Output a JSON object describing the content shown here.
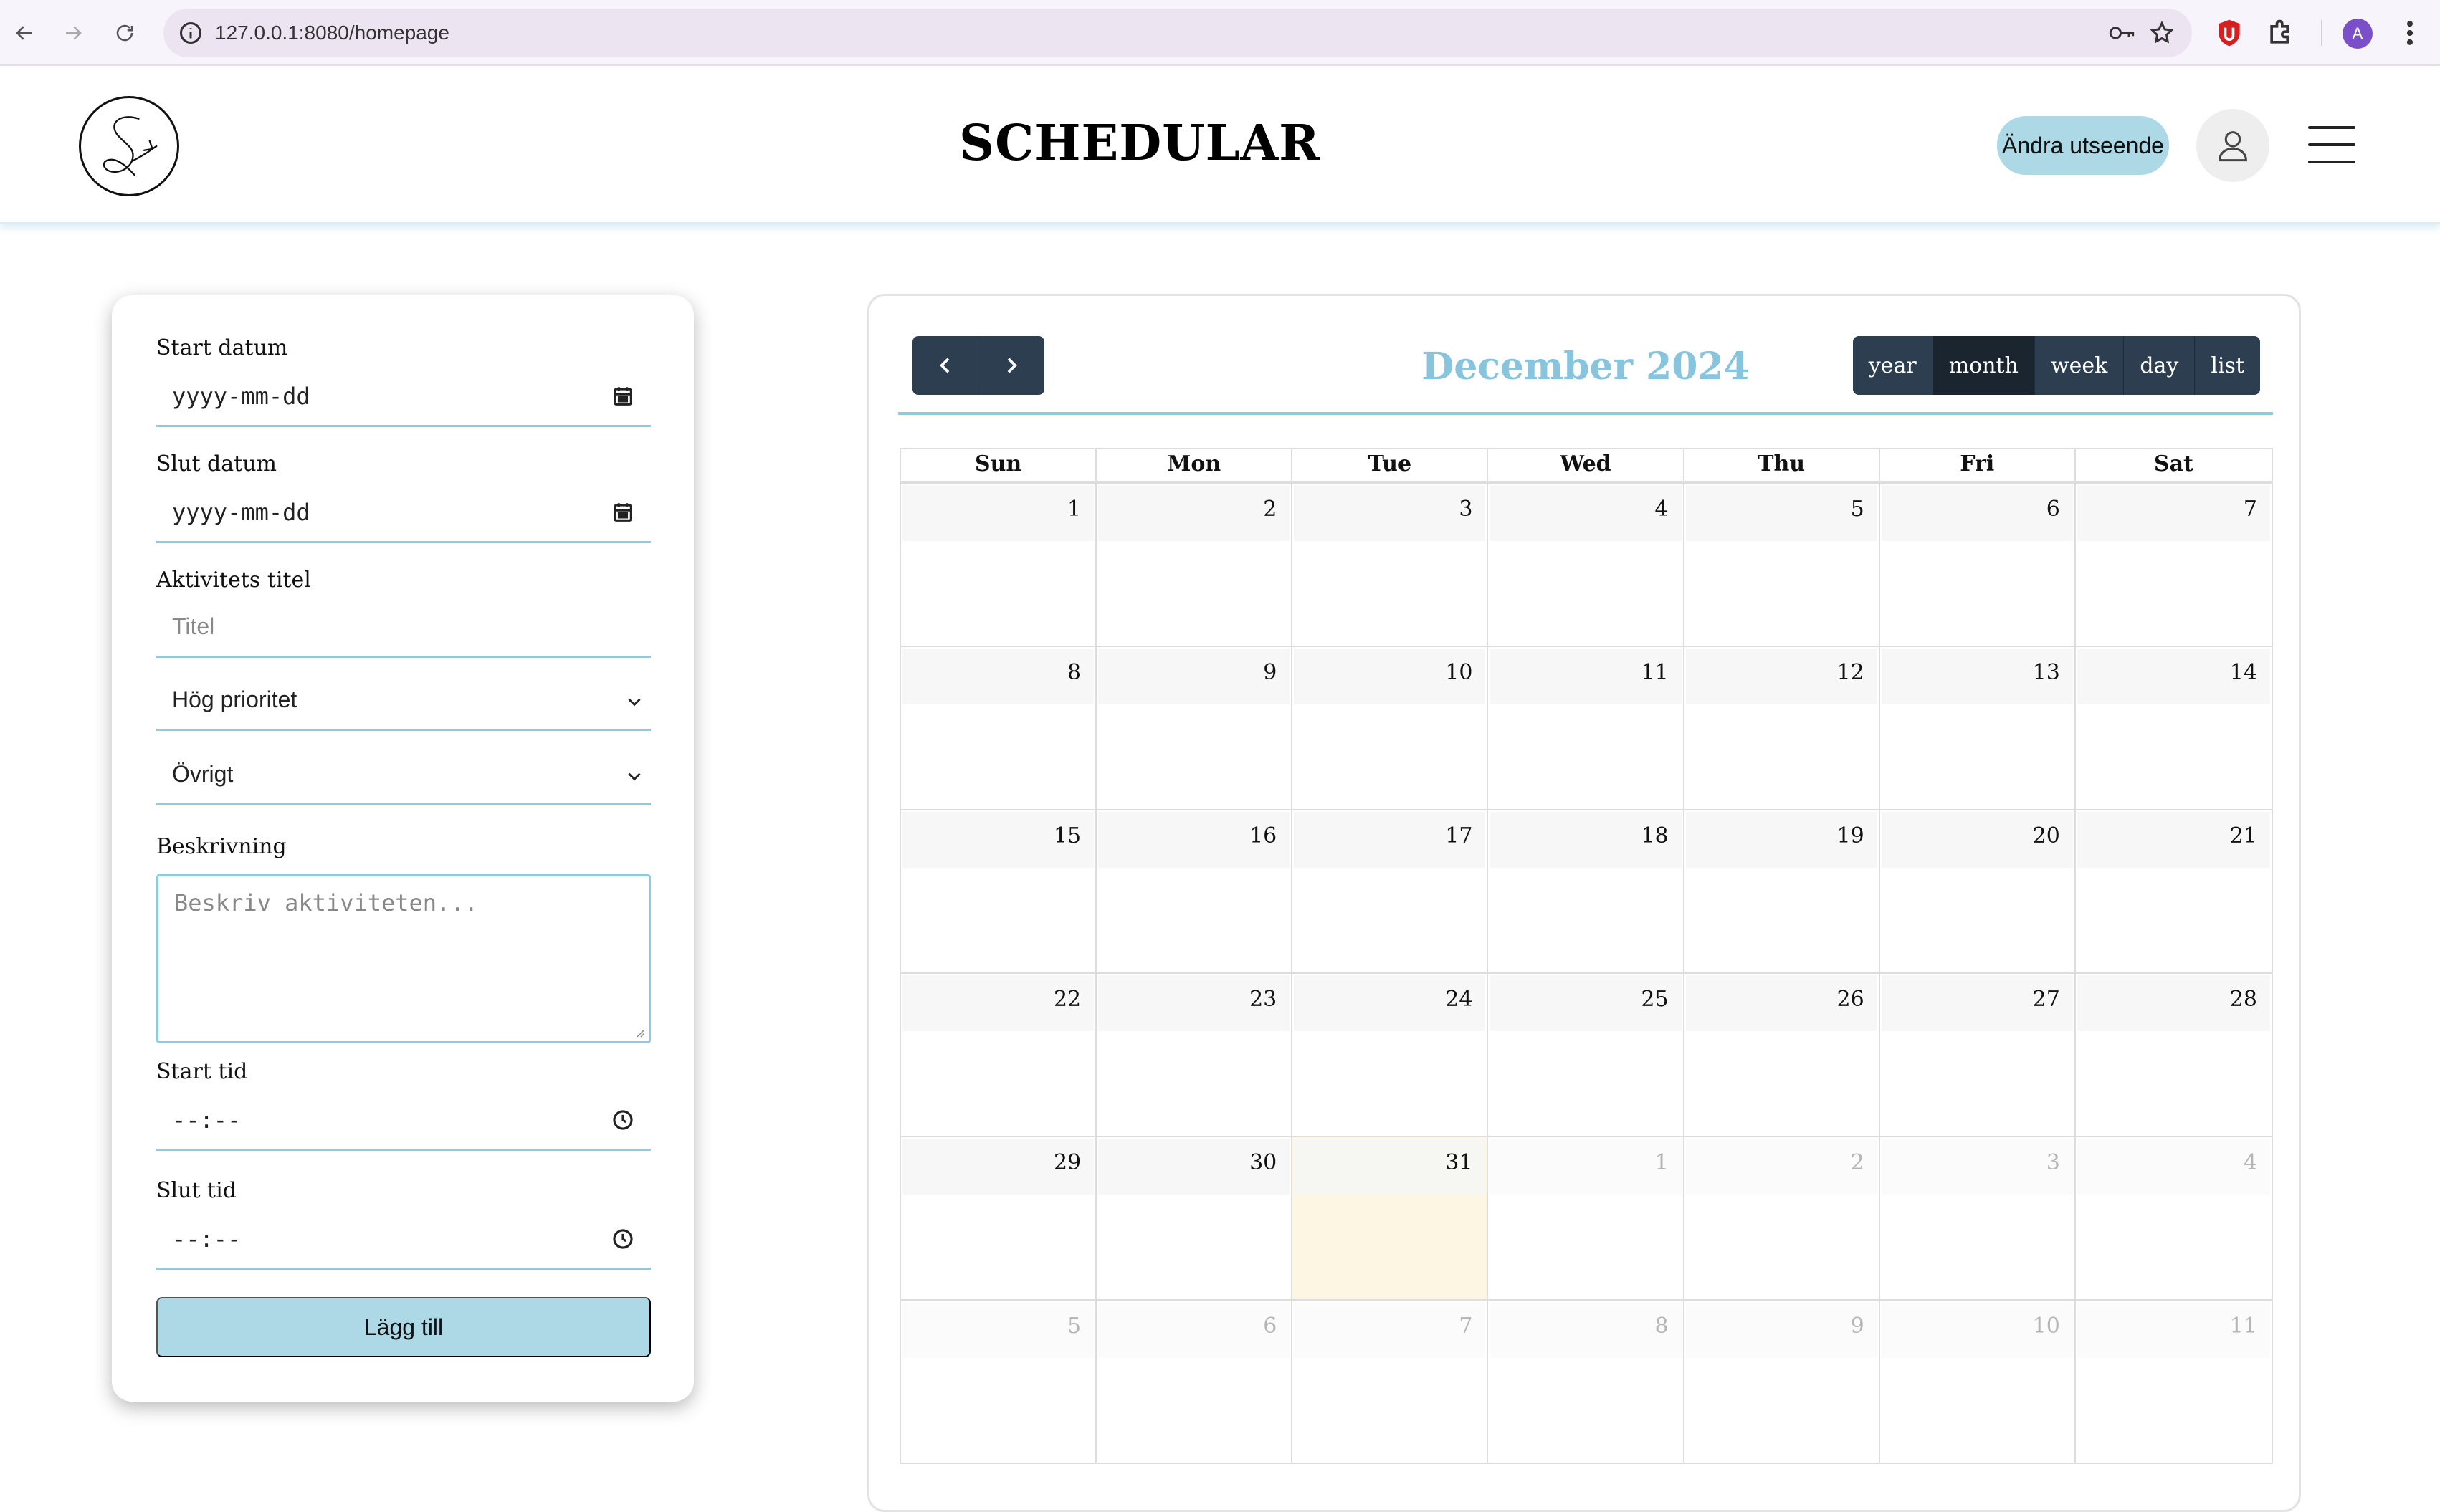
{
  "browser": {
    "url": "127.0.0.1:8080/homepage",
    "profile_initial": "A"
  },
  "header": {
    "title": "SCHEDULAR",
    "theme_button": "Ändra utseende"
  },
  "form": {
    "start_date_label": "Start datum",
    "start_date_value": "yyyy-mm-dd",
    "end_date_label": "Slut datum",
    "end_date_value": "yyyy-mm-dd",
    "title_label": "Aktivitets titel",
    "title_placeholder": "Titel",
    "priority_value": "Hög prioritet",
    "category_value": "Övrigt",
    "description_label": "Beskrivning",
    "description_placeholder": "Beskriv aktiviteten...",
    "start_time_label": "Start tid",
    "start_time_value": "--:--",
    "end_time_label": "Slut tid",
    "end_time_value": "--:--",
    "submit_label": "Lägg till"
  },
  "calendar": {
    "title": "December 2024",
    "views": [
      "year",
      "month",
      "week",
      "day",
      "list"
    ],
    "active_view": "month",
    "weekdays": [
      "Sun",
      "Mon",
      "Tue",
      "Wed",
      "Thu",
      "Fri",
      "Sat"
    ],
    "weeks": [
      [
        {
          "n": "1"
        },
        {
          "n": "2"
        },
        {
          "n": "3"
        },
        {
          "n": "4"
        },
        {
          "n": "5"
        },
        {
          "n": "6"
        },
        {
          "n": "7"
        }
      ],
      [
        {
          "n": "8"
        },
        {
          "n": "9"
        },
        {
          "n": "10"
        },
        {
          "n": "11"
        },
        {
          "n": "12"
        },
        {
          "n": "13"
        },
        {
          "n": "14"
        }
      ],
      [
        {
          "n": "15"
        },
        {
          "n": "16"
        },
        {
          "n": "17"
        },
        {
          "n": "18"
        },
        {
          "n": "19"
        },
        {
          "n": "20"
        },
        {
          "n": "21"
        }
      ],
      [
        {
          "n": "22"
        },
        {
          "n": "23"
        },
        {
          "n": "24"
        },
        {
          "n": "25"
        },
        {
          "n": "26"
        },
        {
          "n": "27"
        },
        {
          "n": "28"
        }
      ],
      [
        {
          "n": "29"
        },
        {
          "n": "30"
        },
        {
          "n": "31",
          "today": true
        },
        {
          "n": "1",
          "other": true
        },
        {
          "n": "2",
          "other": true
        },
        {
          "n": "3",
          "other": true
        },
        {
          "n": "4",
          "other": true
        }
      ],
      [
        {
          "n": "5",
          "other": true
        },
        {
          "n": "6",
          "other": true
        },
        {
          "n": "7",
          "other": true
        },
        {
          "n": "8",
          "other": true
        },
        {
          "n": "9",
          "other": true
        },
        {
          "n": "10",
          "other": true
        },
        {
          "n": "11",
          "other": true
        }
      ]
    ]
  },
  "colors": {
    "accent": "#add8e6",
    "title_blue": "#87c4dd",
    "toolbar_dark": "#2c3e50",
    "today": "#fdf6e3"
  }
}
